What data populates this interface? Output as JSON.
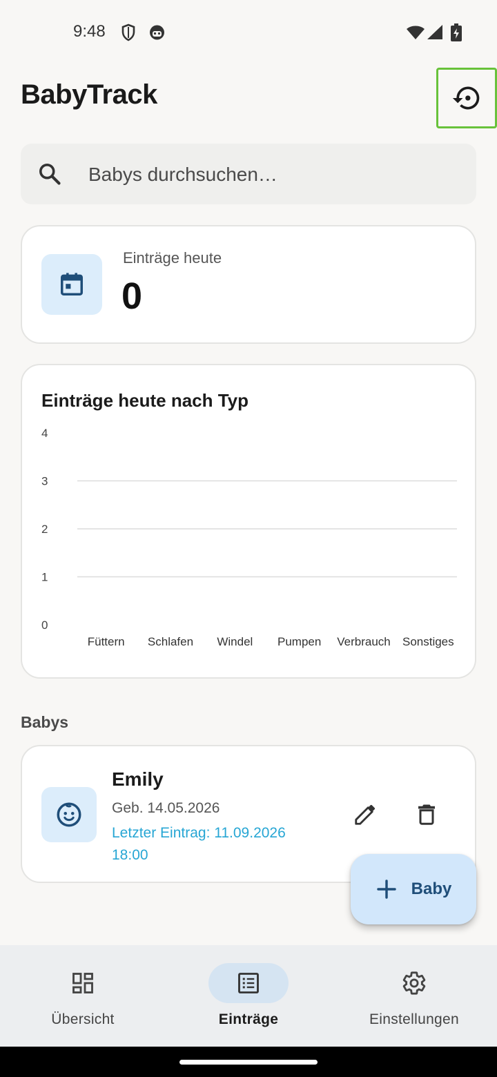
{
  "status_bar": {
    "time": "9:48"
  },
  "header": {
    "title": "BabyTrack"
  },
  "search": {
    "placeholder": "Babys durchsuchen…"
  },
  "stats": {
    "label": "Einträge heute",
    "value": "0"
  },
  "chart_data": {
    "type": "bar",
    "title": "Einträge heute nach Typ",
    "categories": [
      "Füttern",
      "Schlafen",
      "Windel",
      "Pumpen",
      "Verbrauch",
      "Sonstiges"
    ],
    "values": [
      0,
      0,
      0,
      0,
      0,
      0
    ],
    "ylim": [
      0,
      4
    ],
    "yticks": [
      0,
      1,
      2,
      3,
      4
    ],
    "grid": true
  },
  "babies_section": {
    "title": "Babys"
  },
  "babies": [
    {
      "name": "Emily",
      "birth": "Geb. 14.05.2026",
      "last_entry": "Letzter Eintrag: 11.09.2026 18:00"
    }
  ],
  "fab": {
    "label": "Baby"
  },
  "nav": {
    "items": [
      {
        "label": "Übersicht",
        "icon": "dashboard-icon",
        "active": false
      },
      {
        "label": "Einträge",
        "icon": "list-icon",
        "active": true
      },
      {
        "label": "Einstellungen",
        "icon": "gear-icon",
        "active": false
      }
    ]
  },
  "colors": {
    "accent": "#27a6d4",
    "highlight_border": "#68c23a",
    "icon_tile": "#dcedfb",
    "fab": "#d2e7fb"
  }
}
